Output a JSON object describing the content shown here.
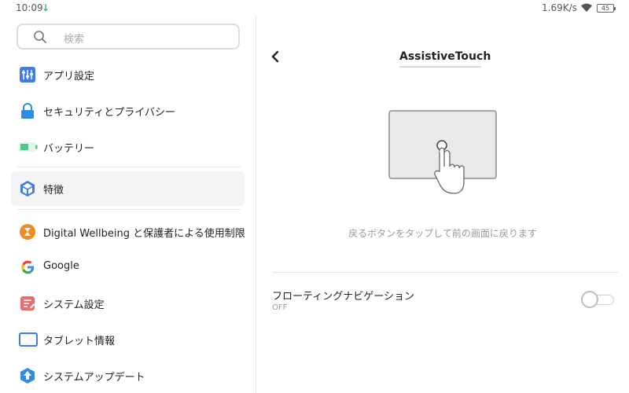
{
  "status_bar": {
    "time": "10:09",
    "download_indicator": "↓",
    "net_speed": "1.69K/s",
    "battery": "45"
  },
  "search": {
    "placeholder": "検索"
  },
  "menu": [
    {
      "label": "アプリ設定",
      "icon": "app-settings-icon",
      "color": "#3d7de8"
    },
    {
      "label": "セキュリティとプライバシー",
      "icon": "lock-icon",
      "color": "#2f8be6"
    },
    {
      "label": "バッテリー",
      "icon": "battery-icon",
      "color": "#48c98a"
    },
    {
      "label": "特徴",
      "icon": "cube-icon",
      "color": "#3d7de8",
      "selected": true
    },
    {
      "label": "Digital Wellbeing と保護者による使用制限",
      "icon": "hourglass-icon",
      "color": "#f08a24"
    },
    {
      "label": "Google",
      "icon": "google-icon",
      "color": "#4285f4"
    },
    {
      "label": "システム設定",
      "icon": "system-settings-icon",
      "color": "#ee6b6b"
    },
    {
      "label": "タブレット情報",
      "icon": "tablet-icon",
      "color": "#3d7de8"
    },
    {
      "label": "システムアップデート",
      "icon": "update-icon",
      "color": "#2f8be6"
    }
  ],
  "detail": {
    "title": "AssistiveTouch",
    "hint": "戻るボタンをタップして前の画面に戻ります",
    "floating_nav": {
      "label": "フローティングナビゲーション",
      "value": "OFF",
      "enabled": false
    }
  }
}
